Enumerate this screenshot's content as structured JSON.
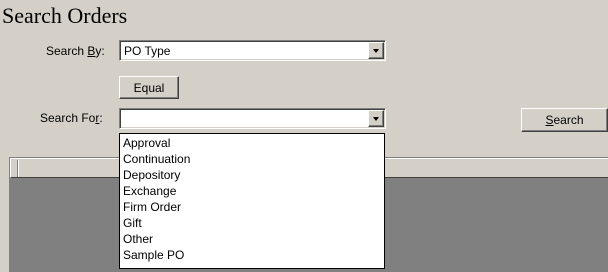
{
  "page": {
    "title": "Search Orders"
  },
  "search_by": {
    "label_prefix": "Search ",
    "label_accel": "B",
    "label_suffix": "y:",
    "value": "PO Type"
  },
  "operator": {
    "label": "Equal"
  },
  "search_for": {
    "label_prefix": "Search Fo",
    "label_accel": "r",
    "label_suffix": ":",
    "value": ""
  },
  "search_button": {
    "label_accel": "S",
    "label_rest": "earch"
  },
  "dropdown_options": [
    "Approval",
    "Continuation",
    "Depository",
    "Exchange",
    "Firm Order",
    "Gift",
    "Other",
    "Sample PO"
  ],
  "colors": {
    "window_bg": "#d4d0c8",
    "grid_bg": "#808080",
    "list_bg": "#ffffff"
  },
  "icons": {
    "combo_arrow": "chevron-down-icon"
  }
}
